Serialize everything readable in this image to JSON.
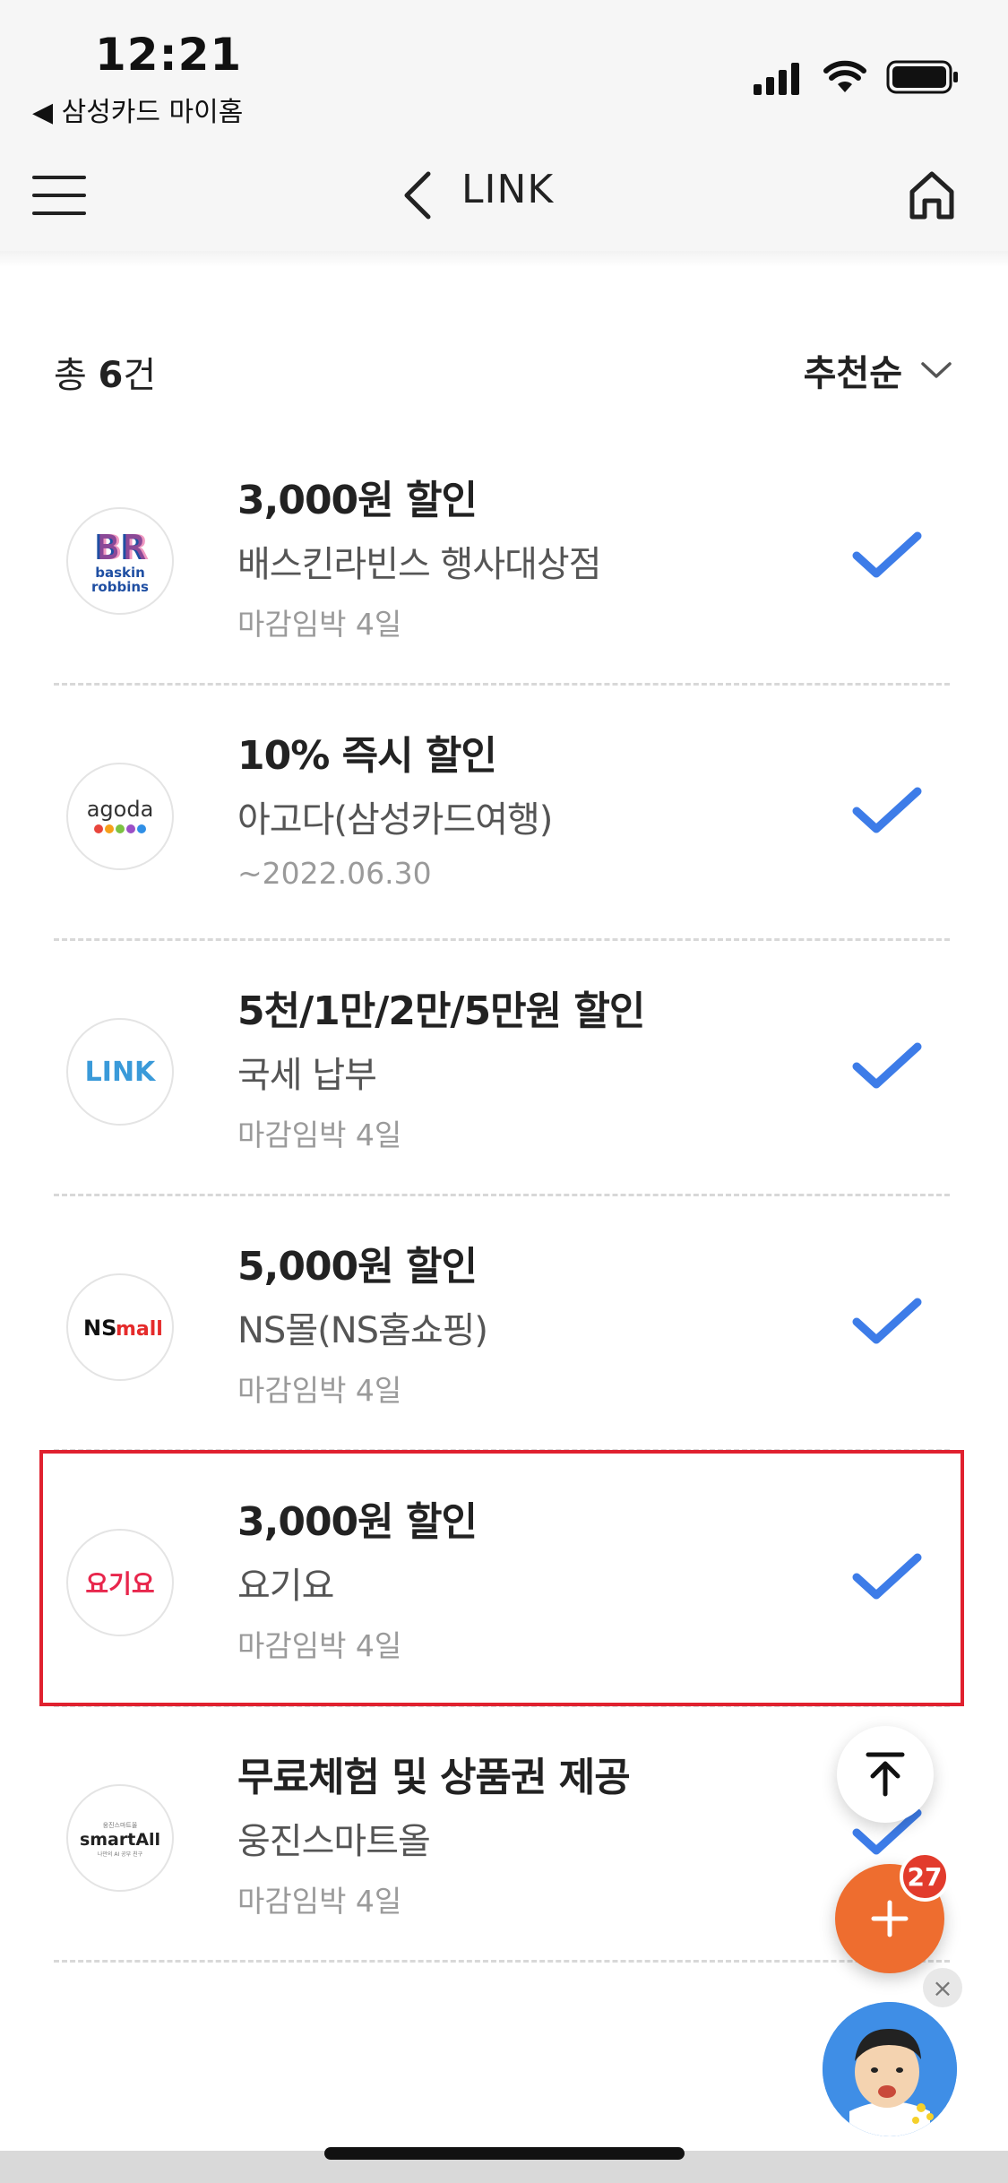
{
  "status_bar": {
    "time": "12:21",
    "back_app": "◀ 삼성카드 마이홈"
  },
  "header": {
    "title": "LINK",
    "menu_icon": "hamburger-menu-icon",
    "back_icon": "chevron-left-icon",
    "home_icon": "home-icon"
  },
  "summary": {
    "count_prefix": "총 ",
    "count_value": "6",
    "count_suffix": "건",
    "sort_label": "추천순"
  },
  "items": [
    {
      "title": "3,000원 할인",
      "merchant": "배스킨라빈스 행사대상점",
      "deadline": "마감임박 4일",
      "logo": "baskin-robbins-logo",
      "checked": true
    },
    {
      "title": "10% 즉시 할인",
      "merchant": "아고다(삼성카드여행)",
      "deadline": "~2022.06.30",
      "logo": "agoda-logo",
      "checked": true
    },
    {
      "title": "5천/1만/2만/5만원 할인",
      "merchant": "국세 납부",
      "deadline": "마감임박 4일",
      "logo": "link-logo",
      "checked": true
    },
    {
      "title": "5,000원 할인",
      "merchant": "NS몰(NS홈쇼핑)",
      "deadline": "마감임박 4일",
      "logo": "nsmall-logo",
      "checked": true
    },
    {
      "title": "3,000원 할인",
      "merchant": "요기요",
      "deadline": "마감임박 4일",
      "logo": "yogiyo-logo",
      "checked": true
    },
    {
      "title": "무료체험 및 상품권 제공",
      "merchant": "웅진스마트올",
      "deadline": "마감임박 4일",
      "logo": "smartall-logo",
      "checked": true
    }
  ],
  "logos": {
    "baskin": {
      "mark": "BR",
      "line1": "baskin",
      "line2": "robbins"
    },
    "agoda": {
      "text": "agoda"
    },
    "link": {
      "text": "LINK"
    },
    "nsmall": {
      "ns": "NS",
      "mall": "mall"
    },
    "yogiyo": {
      "text": "요기요"
    },
    "smartall": {
      "small_top": "웅진스마트올",
      "text": "smartAll",
      "small_bottom": "나만의 AI 공부 친구"
    }
  },
  "floating": {
    "scroll_top_icon": "arrow-up-to-top-icon",
    "plus_icon": "plus-icon",
    "badge_count": "27",
    "close_icon": "close-icon",
    "avatar": "character-avatar"
  },
  "colors": {
    "accent_blue": "#3d7ce8",
    "fab_orange": "#ee6d2f",
    "highlight_red": "#e0212f"
  }
}
